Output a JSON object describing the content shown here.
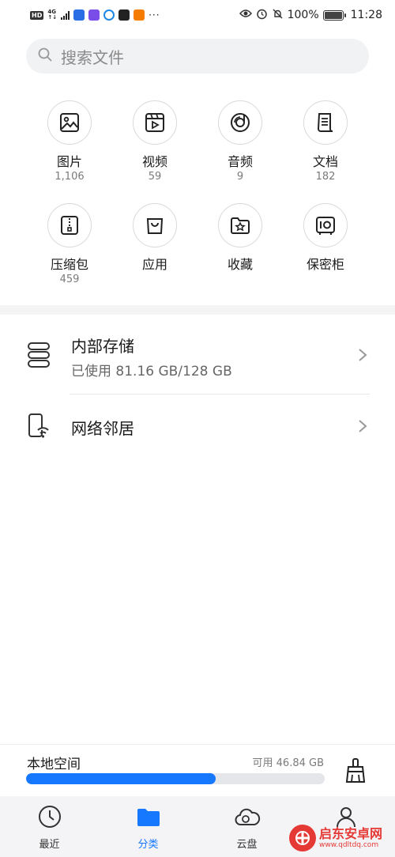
{
  "status_bar": {
    "network": "4G",
    "battery": "100%",
    "time": "11:28",
    "more": "···"
  },
  "search": {
    "placeholder": "搜索文件"
  },
  "categories": [
    {
      "label": "图片",
      "count": "1,106",
      "icon": "image-icon"
    },
    {
      "label": "视频",
      "count": "59",
      "icon": "video-icon"
    },
    {
      "label": "音频",
      "count": "9",
      "icon": "audio-icon"
    },
    {
      "label": "文档",
      "count": "182",
      "icon": "document-icon"
    },
    {
      "label": "压缩包",
      "count": "459",
      "icon": "archive-icon"
    },
    {
      "label": "应用",
      "count": "",
      "icon": "app-bag-icon"
    },
    {
      "label": "收藏",
      "count": "",
      "icon": "favorites-icon"
    },
    {
      "label": "保密柜",
      "count": "",
      "icon": "safe-icon"
    }
  ],
  "locations": {
    "internal": {
      "title": "内部存储",
      "subtitle": "已使用 81.16 GB/128 GB"
    },
    "network": {
      "title": "网络邻居"
    }
  },
  "storage": {
    "title": "本地空间",
    "free": "可用 46.84 GB",
    "used_fraction": 0.634
  },
  "tabs": [
    {
      "label": "最近",
      "icon": "clock-icon",
      "active": false
    },
    {
      "label": "分类",
      "icon": "folder-icon",
      "active": true
    },
    {
      "label": "云盘",
      "icon": "cloud-icon",
      "active": false
    },
    {
      "label": "",
      "icon": "profile-icon",
      "active": false
    }
  ],
  "watermark": {
    "name": "启东安卓网",
    "url": "www.qdltdq.com"
  },
  "colors": {
    "accent": "#1677ff",
    "bar_track": "#e4e6ea",
    "tabbar_bg": "#f4f4f6"
  }
}
